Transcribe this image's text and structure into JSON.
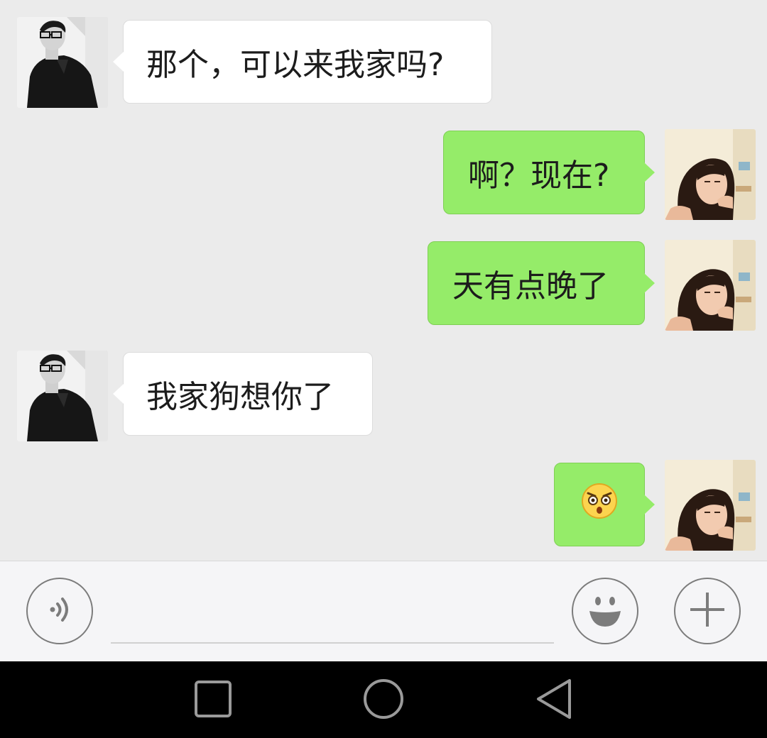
{
  "chat": {
    "messages": [
      {
        "sender": "contact",
        "text": "那个，可以来我家吗?"
      },
      {
        "sender": "me",
        "text": "啊？现在?"
      },
      {
        "sender": "me",
        "text": "天有点晚了"
      },
      {
        "sender": "contact",
        "text": "我家狗想你了"
      },
      {
        "sender": "me",
        "emoji": "shocked-face-emoji"
      }
    ]
  },
  "input_bar": {
    "voice_icon": "voice-icon",
    "emoji_icon": "smiley-face-icon",
    "add_icon": "plus-icon",
    "text_value": ""
  },
  "nav_bar": {
    "recent_icon": "square-icon",
    "home_icon": "circle-icon",
    "back_icon": "triangle-back-icon"
  },
  "colors": {
    "chat_background": "#ebebeb",
    "incoming_bubble": "#ffffff",
    "outgoing_bubble": "#95ec69",
    "input_bar_background": "#f5f5f7",
    "nav_bar_background": "#000000",
    "icon_stroke": "#7c7c7c"
  }
}
